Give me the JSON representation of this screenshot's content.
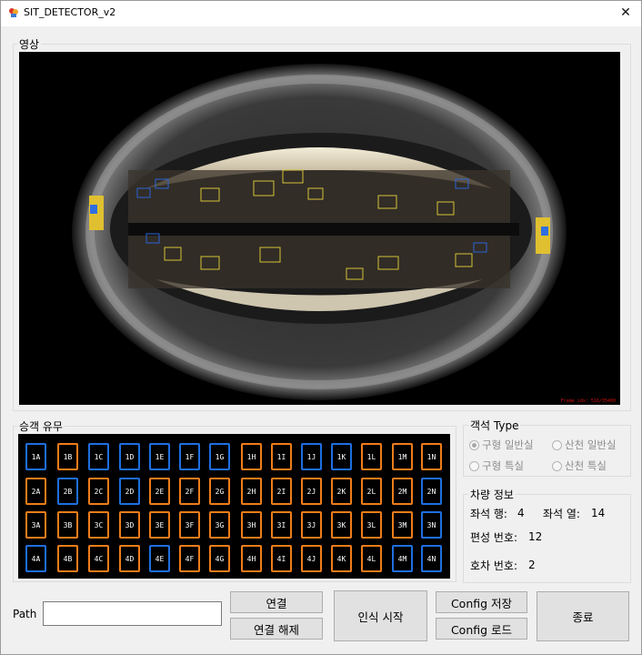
{
  "window": {
    "title": "SIT_DETECTOR_v2",
    "close_glyph": "✕"
  },
  "video": {
    "group_label": "영상",
    "overlay_text": "Frame idx: 516/35400"
  },
  "passengers": {
    "group_label": "승객 유무",
    "rows": [
      {
        "seats": [
          [
            "1A",
            "blue"
          ],
          [
            "1B",
            "orange"
          ],
          [
            "1C",
            "blue"
          ],
          [
            "1D",
            "blue"
          ],
          [
            "1E",
            "blue"
          ],
          [
            "1F",
            "blue"
          ],
          [
            "1G",
            "blue"
          ],
          [
            "1H",
            "orange"
          ],
          [
            "1I",
            "orange"
          ],
          [
            "1J",
            "blue"
          ],
          [
            "1K",
            "blue"
          ],
          [
            "1L",
            "orange"
          ],
          [
            "1M",
            "orange"
          ],
          [
            "1N",
            "orange"
          ]
        ]
      },
      {
        "seats": [
          [
            "2A",
            "orange"
          ],
          [
            "2B",
            "blue"
          ],
          [
            "2C",
            "orange"
          ],
          [
            "2D",
            "blue"
          ],
          [
            "2E",
            "orange"
          ],
          [
            "2F",
            "orange"
          ],
          [
            "2G",
            "orange"
          ],
          [
            "2H",
            "orange"
          ],
          [
            "2I",
            "orange"
          ],
          [
            "2J",
            "orange"
          ],
          [
            "2K",
            "orange"
          ],
          [
            "2L",
            "orange"
          ],
          [
            "2M",
            "orange"
          ],
          [
            "2N",
            "blue"
          ]
        ]
      },
      {
        "seats": [
          [
            "3A",
            "orange"
          ],
          [
            "3B",
            "orange"
          ],
          [
            "3C",
            "orange"
          ],
          [
            "3D",
            "orange"
          ],
          [
            "3E",
            "orange"
          ],
          [
            "3F",
            "orange"
          ],
          [
            "3G",
            "orange"
          ],
          [
            "3H",
            "orange"
          ],
          [
            "3I",
            "orange"
          ],
          [
            "3J",
            "orange"
          ],
          [
            "3K",
            "orange"
          ],
          [
            "3L",
            "orange"
          ],
          [
            "3M",
            "orange"
          ],
          [
            "3N",
            "blue"
          ]
        ]
      },
      {
        "seats": [
          [
            "4A",
            "blue"
          ],
          [
            "4B",
            "orange"
          ],
          [
            "4C",
            "orange"
          ],
          [
            "4D",
            "orange"
          ],
          [
            "4E",
            "blue"
          ],
          [
            "4F",
            "orange"
          ],
          [
            "4G",
            "orange"
          ],
          [
            "4H",
            "orange"
          ],
          [
            "4I",
            "orange"
          ],
          [
            "4J",
            "orange"
          ],
          [
            "4K",
            "orange"
          ],
          [
            "4L",
            "orange"
          ],
          [
            "4M",
            "blue"
          ],
          [
            "4N",
            "blue"
          ]
        ]
      }
    ]
  },
  "car_type": {
    "group_label": "객석 Type",
    "options": [
      {
        "label": "구형 일반실",
        "checked": true
      },
      {
        "label": "산천 일반실",
        "checked": false
      },
      {
        "label": "구형 특실",
        "checked": false
      },
      {
        "label": "산천 특실",
        "checked": false
      }
    ]
  },
  "vehicle_info": {
    "group_label": "차량 정보",
    "seat_row_label": "좌석 행:",
    "seat_row_value": "4",
    "seat_col_label": "좌석 열:",
    "seat_col_value": "14",
    "formation_label": "편성 번호:",
    "formation_value": "12",
    "car_label": "호차 번호:",
    "car_value": "2"
  },
  "path": {
    "label": "Path",
    "value": ""
  },
  "buttons": {
    "connect": "연결",
    "disconnect": "연결 해제",
    "start": "인식 시작",
    "config_save": "Config 저장",
    "config_load": "Config 로드",
    "exit": "종료"
  },
  "colors": {
    "occupied": "#ef7d1a",
    "empty": "#1e6fe0"
  }
}
